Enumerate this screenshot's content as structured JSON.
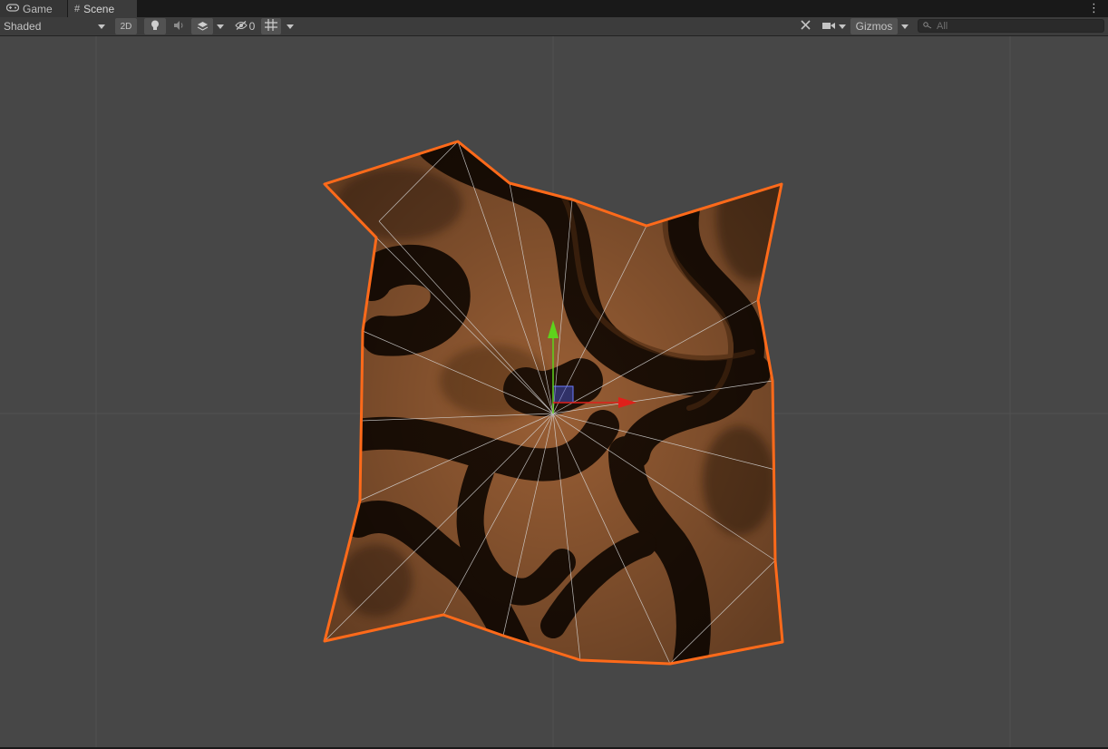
{
  "tabs": [
    {
      "label": "Game",
      "icon": "gamepad-icon",
      "active": false
    },
    {
      "label": "Scene",
      "icon": "grid-hash-icon",
      "active": true
    }
  ],
  "toolbar": {
    "draw_mode": "Shaded",
    "mode_2d_label": "2D",
    "hidden_count": "0",
    "gizmos_label": "Gizmos",
    "search_placeholder": "All"
  },
  "colors": {
    "viewport_bg": "#474747",
    "selection_outline": "#ff6a1a",
    "mesh_light": "#a0643a",
    "mesh_dark": "#1c0f05",
    "axis_x": "#e0201a",
    "axis_y": "#5ed21c",
    "axis_z": "#4a5be0",
    "wireframe": "#e8e8e8"
  }
}
